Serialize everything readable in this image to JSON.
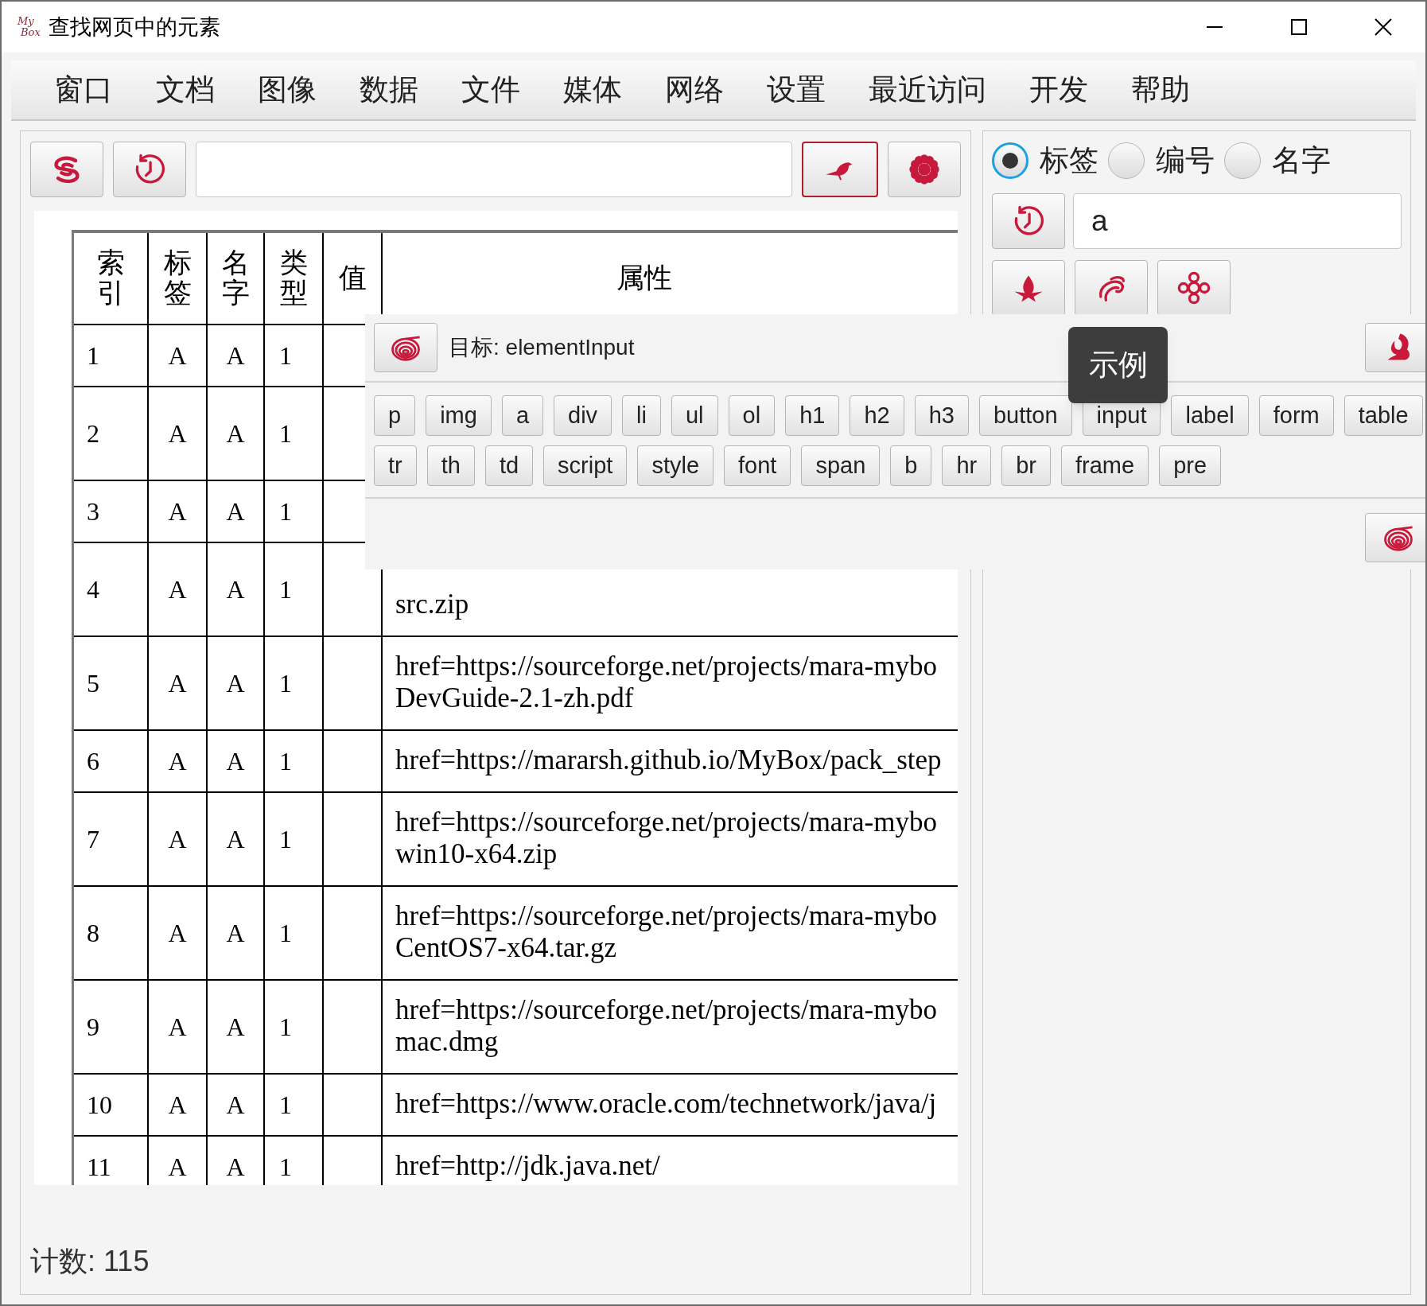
{
  "window": {
    "title": "查找网页中的元素",
    "logo_lines": [
      "My",
      "Box"
    ]
  },
  "menu": [
    "窗口",
    "文档",
    "图像",
    "数据",
    "文件",
    "媒体",
    "网络",
    "设置",
    "最近访问",
    "开发",
    "帮助"
  ],
  "table": {
    "columns": [
      "索引",
      "标签",
      "名字",
      "类型",
      "值",
      "属性"
    ],
    "rows": [
      {
        "kind": "single",
        "index": "1",
        "tag": "A",
        "name": "A",
        "type": "1"
      },
      {
        "kind": "wrapped",
        "index": "2",
        "tag": "A",
        "name": "A",
        "type": "1"
      },
      {
        "kind": "single",
        "index": "3",
        "tag": "A",
        "name": "A",
        "type": "1"
      },
      {
        "kind": "wrapped",
        "index": "4",
        "tag": "A",
        "name": "A",
        "type": "1",
        "attributes": [
          "src.zip"
        ]
      },
      {
        "kind": "wrapped",
        "index": "5",
        "tag": "A",
        "name": "A",
        "type": "1",
        "attributes": [
          "href=https://sourceforge.net/projects/mara-mybo",
          "DevGuide-2.1-zh.pdf"
        ]
      },
      {
        "kind": "single",
        "index": "6",
        "tag": "A",
        "name": "A",
        "type": "1",
        "attributes": [
          "href=https://mararsh.github.io/MyBox/pack_step"
        ]
      },
      {
        "kind": "wrapped",
        "index": "7",
        "tag": "A",
        "name": "A",
        "type": "1",
        "attributes": [
          "href=https://sourceforge.net/projects/mara-mybo",
          "win10-x64.zip"
        ]
      },
      {
        "kind": "wrapped",
        "index": "8",
        "tag": "A",
        "name": "A",
        "type": "1",
        "attributes": [
          "href=https://sourceforge.net/projects/mara-mybo",
          "CentOS7-x64.tar.gz"
        ]
      },
      {
        "kind": "wrapped",
        "index": "9",
        "tag": "A",
        "name": "A",
        "type": "1",
        "attributes": [
          "href=https://sourceforge.net/projects/mara-mybo",
          "mac.dmg"
        ]
      },
      {
        "kind": "single",
        "index": "10",
        "tag": "A",
        "name": "A",
        "type": "1",
        "attributes": [
          "href=https://www.oracle.com/technetwork/java/j"
        ]
      },
      {
        "kind": "single",
        "index": "11",
        "tag": "A",
        "name": "A",
        "type": "1",
        "attributes": [
          "href=http://jdk.java.net/"
        ]
      }
    ]
  },
  "count": "计数: 115",
  "match_modes": [
    {
      "label": "标签",
      "selected": true
    },
    {
      "label": "编号",
      "selected": false
    },
    {
      "label": "名字",
      "selected": false
    }
  ],
  "match_value": "a",
  "popup": {
    "target": "目标: elementInput",
    "tooltip": "示例",
    "tag_rows": [
      [
        "p",
        "img",
        "a",
        "div",
        "li",
        "ul",
        "ol",
        "h1",
        "h2",
        "h3",
        "button",
        "input",
        "label",
        "form",
        "table"
      ],
      [
        "tr",
        "th",
        "td",
        "script",
        "style",
        "font",
        "span",
        "b",
        "hr",
        "br",
        "frame",
        "pre"
      ]
    ]
  }
}
